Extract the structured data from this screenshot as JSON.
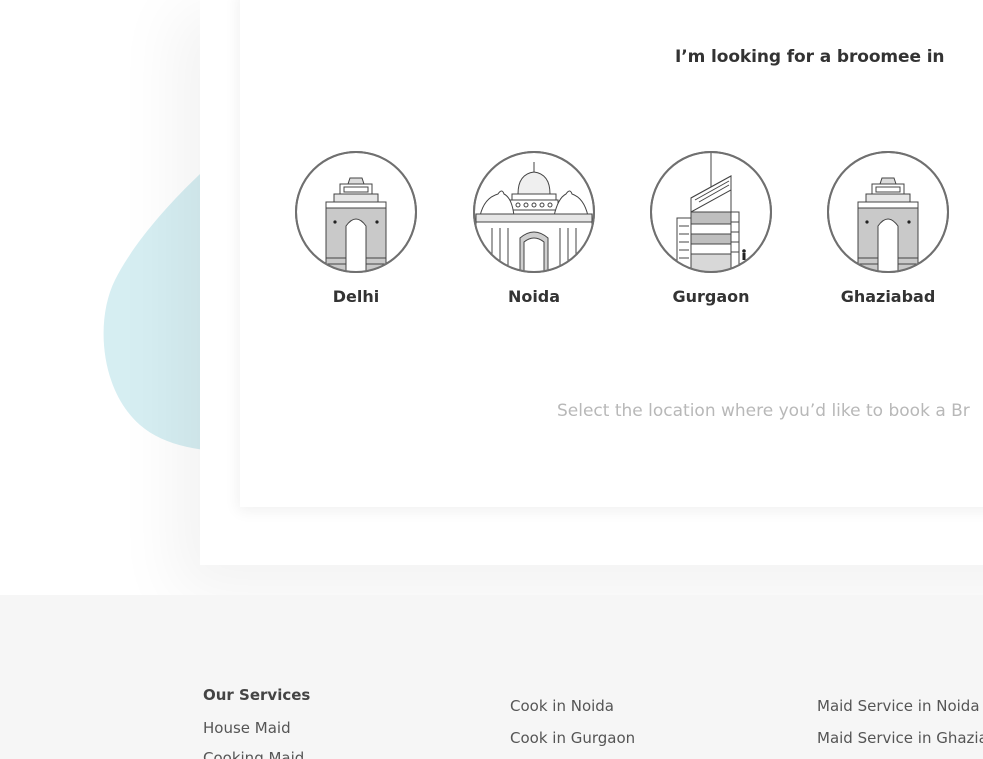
{
  "selector": {
    "heading": "I’m looking for a broomee in",
    "hint": "Select the location where you’d like to book a Br",
    "cities": [
      {
        "label": "Delhi",
        "icon": "india-gate-icon"
      },
      {
        "label": "Noida",
        "icon": "domed-palace-icon"
      },
      {
        "label": "Gurgaon",
        "icon": "skyscraper-icon"
      },
      {
        "label": "Ghaziabad",
        "icon": "india-gate-icon"
      }
    ]
  },
  "footer": {
    "services_title": "Our Services",
    "services": [
      "House Maid",
      "Cooking Maid"
    ],
    "col2": [
      "Cook in Noida",
      "Cook in Gurgaon"
    ],
    "col3": [
      "Maid Service in Noida",
      "Maid Service in Ghazia"
    ]
  },
  "colors": {
    "blob": "#d6eef2",
    "footer_bg": "#f6f6f6",
    "heading": "#333333",
    "hint": "#b8b8b8"
  }
}
